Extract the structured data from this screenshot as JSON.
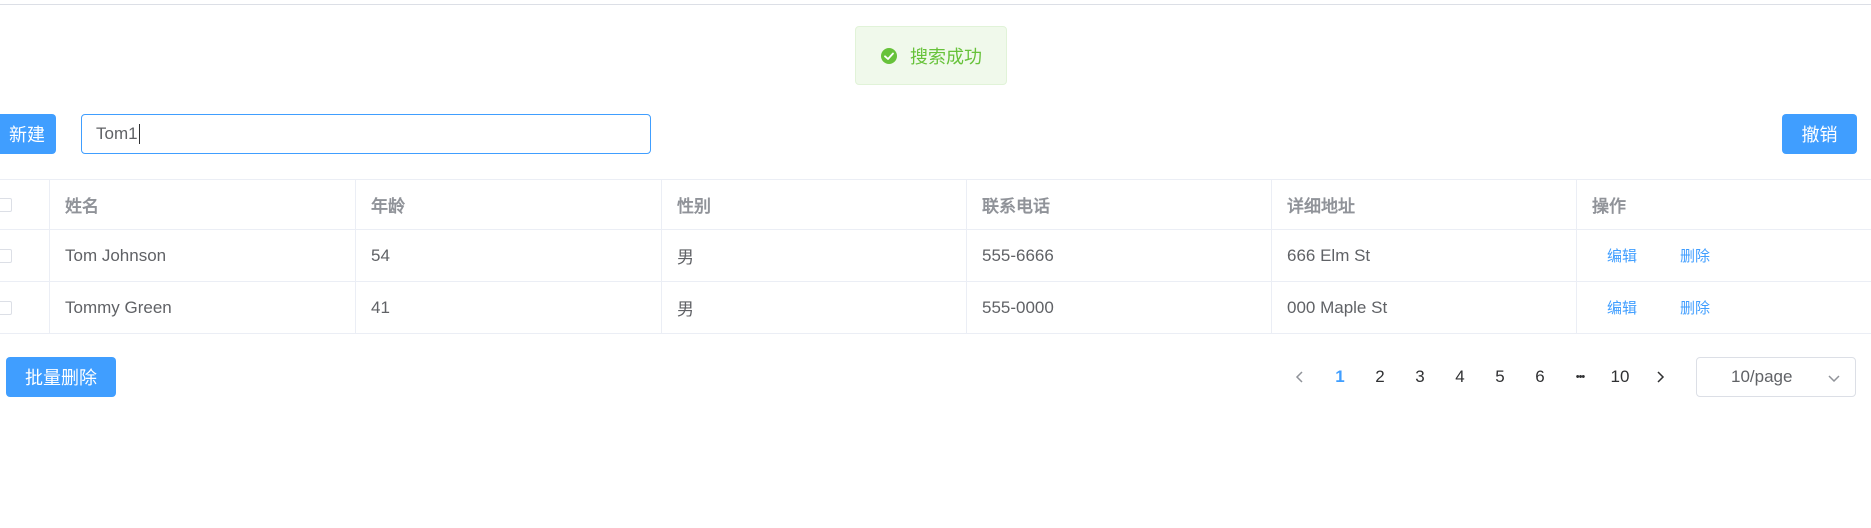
{
  "toast": {
    "message": "搜索成功",
    "icon": "success-check-icon",
    "color": "#67c23a"
  },
  "toolbar": {
    "new_label": "新建",
    "cancel_label": "撤销",
    "batch_delete_label": "批量删除"
  },
  "search": {
    "value": "Tom1",
    "placeholder": ""
  },
  "table": {
    "headers": [
      "姓名",
      "年龄",
      "性别",
      "联系电话",
      "详细地址",
      "操作"
    ],
    "rows": [
      {
        "name": "Tom Johnson",
        "age": "54",
        "gender": "男",
        "phone": "555-6666",
        "address": "666 Elm St",
        "edit": "编辑",
        "delete": "删除"
      },
      {
        "name": "Tommy Green",
        "age": "41",
        "gender": "男",
        "phone": "555-0000",
        "address": "000 Maple St",
        "edit": "编辑",
        "delete": "删除"
      }
    ]
  },
  "pagination": {
    "pages": [
      "1",
      "2",
      "3",
      "4",
      "5",
      "6"
    ],
    "ellipsis": "•••",
    "last": "10",
    "current": "1",
    "page_size": "10/page"
  },
  "colors": {
    "primary": "#409eff",
    "success": "#67c23a"
  }
}
